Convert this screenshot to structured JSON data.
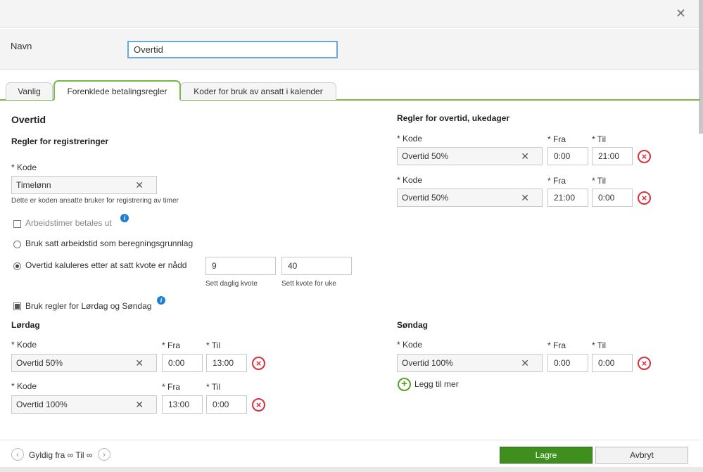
{
  "dialog": {
    "close_icon": "✕"
  },
  "name": {
    "label": "Navn",
    "value": "Overtid"
  },
  "tabs": [
    {
      "label": "Vanlig"
    },
    {
      "label": "Forenklede betalingsregler"
    },
    {
      "label": "Koder for bruk av ansatt i kalender"
    }
  ],
  "left": {
    "title": "Overtid",
    "registration_header": "Regler for registreringer",
    "code_label": "* Kode",
    "code_value": "Timelønn",
    "code_hint": "Dette er koden ansatte bruker for registrering av timer",
    "options": {
      "work_hours_paid": "Arbeidstimer betales ut",
      "use_set_hours": "Bruk satt arbeidstid som beregningsgrunnlag",
      "overtime_after_quota": "Overtid kaluleres etter at satt kvote er nådd"
    },
    "daily_quota": {
      "value": "9",
      "label": "Sett daglig kvote"
    },
    "weekly_quota": {
      "value": "40",
      "label": "Sett kvote for uke"
    },
    "weekend_rules": "Bruk regler for Lørdag og Søndag"
  },
  "weekdays": {
    "header": "Regler for overtid, ukedager",
    "rows": [
      {
        "code_label": "* Kode",
        "from_label": "* Fra",
        "to_label": "* Til",
        "code": "Overtid 50%",
        "from": "0:00",
        "to": "21:00"
      },
      {
        "code_label": "* Kode",
        "from_label": "* Fra",
        "to_label": "* Til",
        "code": "Overtid 50%",
        "from": "21:00",
        "to": "0:00"
      }
    ]
  },
  "saturday": {
    "header": "Lørdag",
    "rows": [
      {
        "code_label": "* Kode",
        "from_label": "* Fra",
        "to_label": "* Til",
        "code": "Overtid 50%",
        "from": "0:00",
        "to": "13:00"
      },
      {
        "code_label": "* Kode",
        "from_label": "* Fra",
        "to_label": "* Til",
        "code": "Overtid 100%",
        "from": "13:00",
        "to": "0:00"
      }
    ]
  },
  "sunday": {
    "header": "Søndag",
    "rows": [
      {
        "code_label": "* Kode",
        "from_label": "* Fra",
        "to_label": "* Til",
        "code": "Overtid 100%",
        "from": "0:00",
        "to": "0:00"
      }
    ],
    "add_more": "Legg til mer"
  },
  "footer": {
    "validity": "Gyldig fra ∞ Til ∞",
    "save": "Lagre",
    "cancel": "Avbryt"
  },
  "colors": {
    "accent_green": "#7ab648",
    "save_green": "#3f8f1e",
    "delete_red": "#d9303a",
    "info_blue": "#1f7fd1"
  }
}
